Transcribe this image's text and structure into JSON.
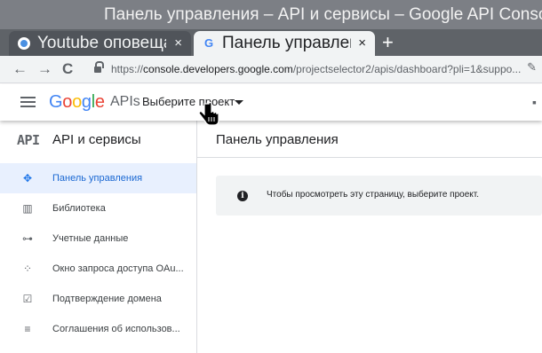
{
  "window": {
    "title": "Панель управления – API и сервисы – Google API Console -"
  },
  "tabs": [
    {
      "title": "Youtube оповещатель",
      "close": "×",
      "active": false
    },
    {
      "favicon": "G",
      "title": "Панель управления",
      "close": "×",
      "active": true
    }
  ],
  "new_tab": "+",
  "toolbar": {
    "back": "←",
    "forward": "→",
    "reload": "C",
    "url_scheme": "https://",
    "url_host": "console.developers.google.com",
    "url_path": "/projectselector2/apis/dashboard?pli=1&suppo..."
  },
  "header": {
    "logo_letters": [
      {
        "ch": "G",
        "color": "#4285F4"
      },
      {
        "ch": "o",
        "color": "#EA4335"
      },
      {
        "ch": "o",
        "color": "#FBBC05"
      },
      {
        "ch": "g",
        "color": "#4285F4"
      },
      {
        "ch": "l",
        "color": "#34A853"
      },
      {
        "ch": "e",
        "color": "#EA4335"
      }
    ],
    "apis_label": "APIs",
    "project_selector": "Выберите проект"
  },
  "sidebar": {
    "api_mark": "API",
    "title": "API и сервисы",
    "items": [
      {
        "label": "Панель управления",
        "icon": "dashboard-icon",
        "glyph": "✥",
        "active": true
      },
      {
        "label": "Библиотека",
        "icon": "library-icon",
        "glyph": "▥",
        "active": false
      },
      {
        "label": "Учетные данные",
        "icon": "key-icon",
        "glyph": "⊶",
        "active": false
      },
      {
        "label": "Окно запроса доступа OAu...",
        "icon": "consent-screen-icon",
        "glyph": "⁘",
        "active": false
      },
      {
        "label": "Подтверждение домена",
        "icon": "domain-verification-icon",
        "glyph": "☑",
        "active": false
      },
      {
        "label": "Соглашения об использов...",
        "icon": "agreements-icon",
        "glyph": "≡",
        "active": false
      }
    ]
  },
  "main": {
    "title": "Панель управления",
    "info_icon": "i",
    "info_text": "Чтобы просмотреть эту страницу, выберите проект."
  },
  "colors": {
    "accent": "#1A73E8",
    "active_bg": "#E8F0FE"
  }
}
